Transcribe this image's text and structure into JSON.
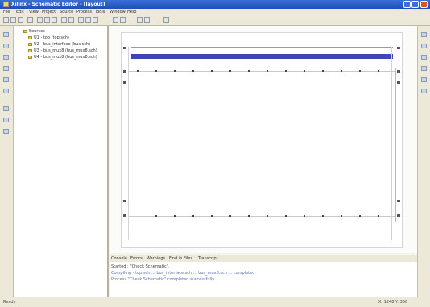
{
  "window": {
    "title": "Xilinx - Schematic Editor - [layout]",
    "buttons": [
      "minimize",
      "maximize",
      "close"
    ]
  },
  "menubar": {
    "items": [
      "File",
      "Edit",
      "View",
      "Project",
      "Source",
      "Process",
      "Tools",
      "Window",
      "Help"
    ]
  },
  "toolbar": {
    "icons": [
      "new-icon",
      "open-icon",
      "save-icon",
      "print-icon",
      "cut-icon",
      "copy-icon",
      "paste-icon",
      "undo-icon",
      "redo-icon",
      "zoom-in-icon",
      "zoom-out-icon",
      "zoom-fit-icon",
      "grid-icon",
      "wire-icon",
      "bus-icon",
      "net-name-icon",
      "symbol-icon"
    ]
  },
  "tree": {
    "items": [
      {
        "label": "Sources",
        "level": 0
      },
      {
        "label": "U1 - top (top.sch)",
        "level": 1
      },
      {
        "label": "U2 - bus_interface (bus.sch)",
        "level": 1
      },
      {
        "label": "U3 - bus_mux8 (bus_mux8.sch)",
        "level": 1
      },
      {
        "label": "U4 - bus_mux8 (bus_mux8.sch)",
        "level": 1
      }
    ]
  },
  "output": {
    "tabs": [
      "Console",
      "Errors",
      "Warnings",
      "Find in Files",
      "Transcript"
    ],
    "lines": [
      "Started : \"Check Schematic\".",
      "Compiling - top.sch ... bus_interface.sch ... bus_mux8.sch ... completed",
      "Process \"Check Schematic\" completed successfully"
    ]
  },
  "status": {
    "left": "Ready",
    "right": "X: 1248  Y: 356"
  },
  "colors": {
    "titlebar": "#1d4fb8",
    "bus_line": "#3f45b5"
  }
}
